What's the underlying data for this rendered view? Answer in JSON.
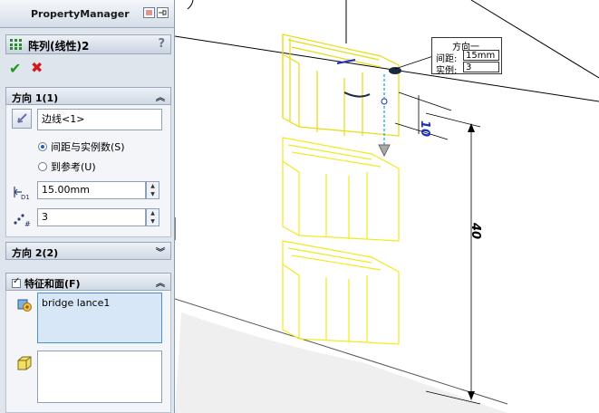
{
  "property_manager": {
    "title": "PropertyManager",
    "feature_name": "阵列(线性)2",
    "help": "?",
    "ok_symbol": "✔",
    "cancel_symbol": "✖",
    "direction1": {
      "header": "方向 1(1)",
      "edge_value": "边线<1>",
      "radio_spacing": "间距与实例数(S)",
      "radio_reference": "到参考(U)",
      "spacing_value": "15.00mm",
      "instances_value": "3",
      "spacing_icon_label": "D1",
      "instances_icon_label": "#"
    },
    "direction2": {
      "header": "方向 2(2)"
    },
    "features": {
      "header": "特征和面(F)",
      "items": [
        "bridge lance1"
      ]
    }
  },
  "callout": {
    "title": "方向一",
    "spacing_label": "间距:",
    "spacing_value": "15mm",
    "instances_label": "实例:",
    "instances_value": "3"
  },
  "dimensions": {
    "small": "10",
    "large": "40"
  },
  "colors": {
    "preview": "#f2ea1e",
    "accent": "#1a2fc0",
    "ok": "#1d9a1d",
    "cancel": "#d21a1a"
  }
}
